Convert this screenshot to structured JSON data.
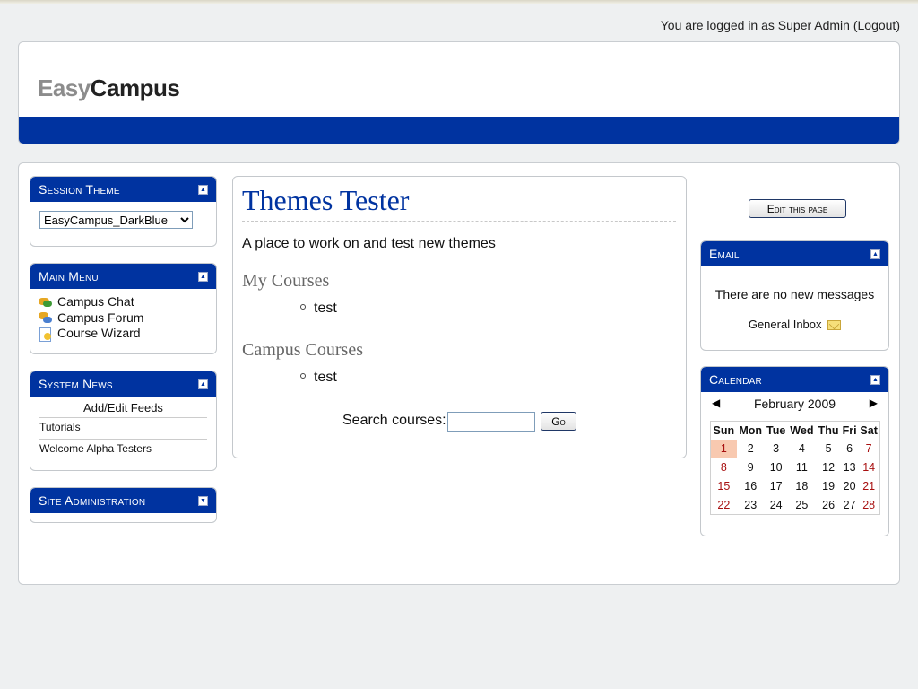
{
  "login": {
    "prefix": "You are logged in as ",
    "user": "Super Admin",
    "logout": "(Logout)"
  },
  "logo": {
    "part1": "Easy",
    "part2": "Campus"
  },
  "colors": {
    "brand_blue": "#0033a0",
    "today_highlight": "#f8c9b0",
    "weekend_red": "#a81010"
  },
  "session_theme": {
    "title": "Session Theme",
    "selected": "EasyCampus_DarkBlue"
  },
  "main_menu": {
    "title": "Main Menu",
    "items": [
      {
        "label": "Campus Chat",
        "icon": "chat-icon"
      },
      {
        "label": "Campus Forum",
        "icon": "forum-icon"
      },
      {
        "label": "Course Wizard",
        "icon": "wizard-icon"
      }
    ]
  },
  "system_news": {
    "title": "System News",
    "add_edit": "Add/Edit Feeds",
    "items": [
      "Tutorials",
      "Welcome Alpha Testers"
    ]
  },
  "site_admin": {
    "title": "Site Administration"
  },
  "main": {
    "title": "Themes Tester",
    "subtitle": "A place to work on and test new themes",
    "my_courses_title": "My Courses",
    "my_courses": [
      "test"
    ],
    "campus_courses_title": "Campus Courses",
    "campus_courses": [
      "test"
    ],
    "search_label": "Search courses:",
    "search_value": "",
    "go_label": "Go"
  },
  "edit_page_label": "Edit this page",
  "email": {
    "title": "Email",
    "message": "There are no new messages",
    "inbox": "General Inbox"
  },
  "calendar": {
    "title": "Calendar",
    "prev": "◀",
    "next": "▶",
    "month": "February 2009",
    "weekdays": [
      "Sun",
      "Mon",
      "Tue",
      "Wed",
      "Thu",
      "Fri",
      "Sat"
    ],
    "weeks": [
      [
        "1",
        "2",
        "3",
        "4",
        "5",
        "6",
        "7"
      ],
      [
        "8",
        "9",
        "10",
        "11",
        "12",
        "13",
        "14"
      ],
      [
        "15",
        "16",
        "17",
        "18",
        "19",
        "20",
        "21"
      ],
      [
        "22",
        "23",
        "24",
        "25",
        "26",
        "27",
        "28"
      ]
    ],
    "today": "1"
  }
}
